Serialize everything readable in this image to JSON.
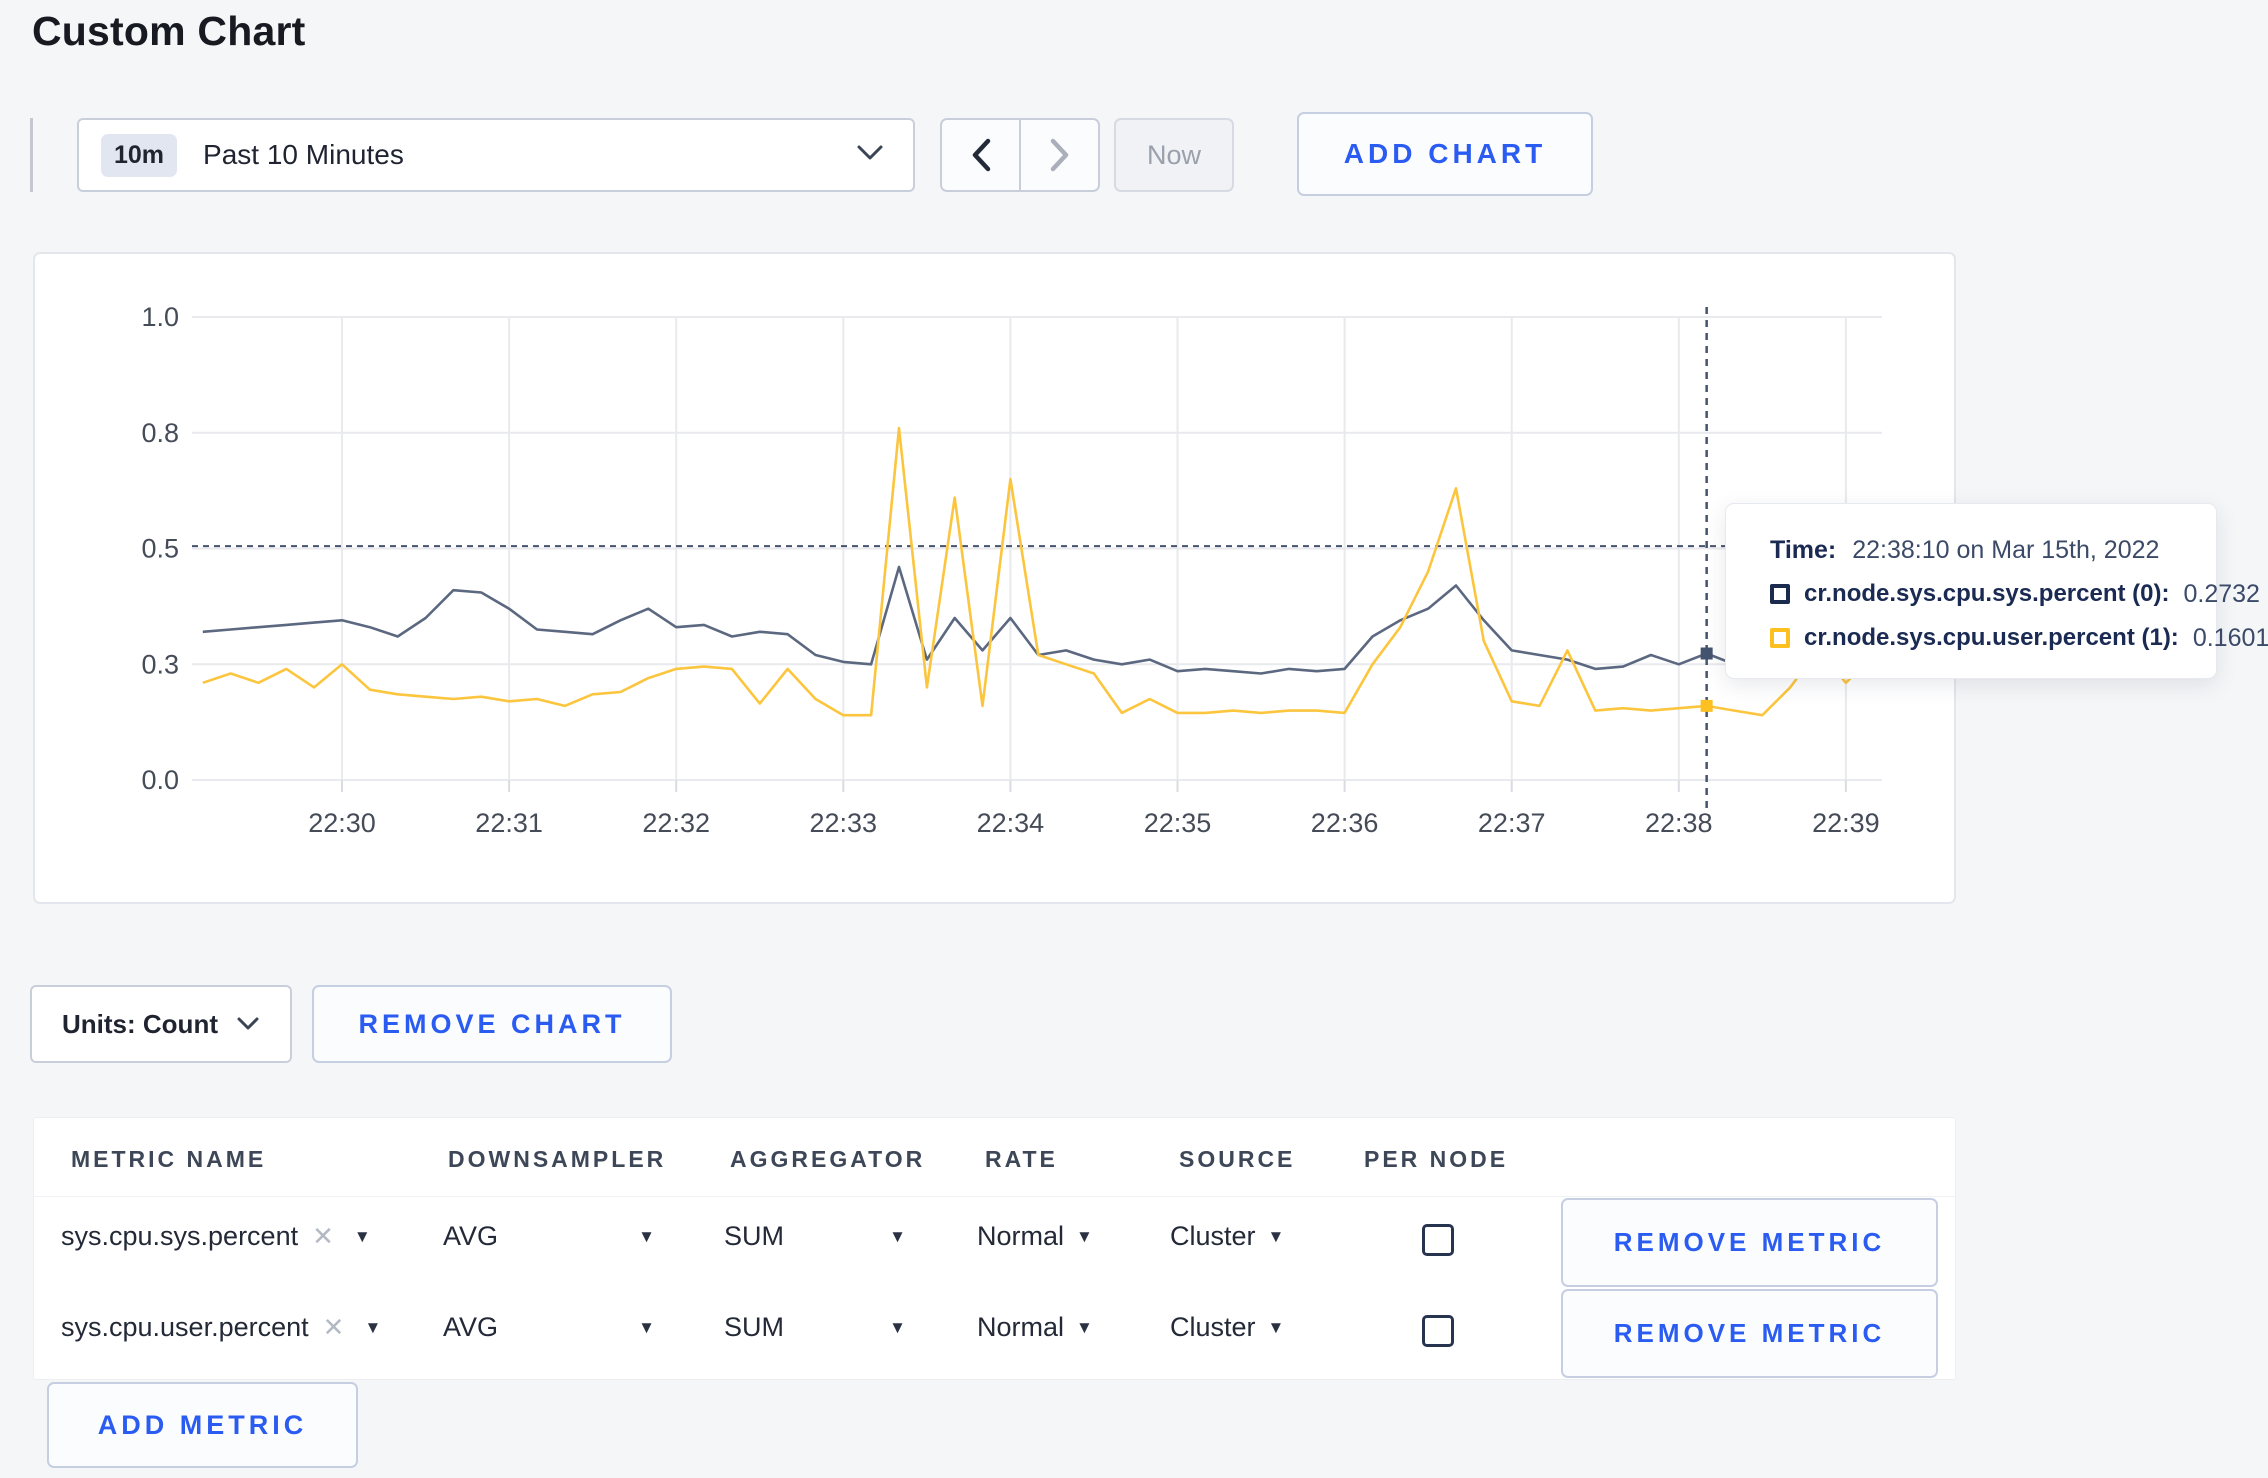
{
  "page": {
    "title": "Custom Chart"
  },
  "colors": {
    "accent_blue": "#2b5cf2",
    "series_sys": "#5b6880",
    "series_user": "#fcc53e",
    "swatch_sys": "#1b2b4e",
    "swatch_user": "#fdc021",
    "crosshair": "#45536e",
    "gridline": "#e9eaee",
    "axis_text": "#454b57"
  },
  "toolbar": {
    "time_range_badge": "10m",
    "time_range_label": "Past 10 Minutes",
    "now_label": "Now",
    "add_chart_label": "ADD CHART"
  },
  "tooltip": {
    "time_label": "Time:",
    "time_value": "22:38:10 on Mar 15th, 2022",
    "series": [
      {
        "label": "cr.node.sys.cpu.sys.percent (0):",
        "value": "0.2732",
        "color": "#1b2b4e"
      },
      {
        "label": "cr.node.sys.cpu.user.percent (1):",
        "value": "0.1601",
        "color": "#fdc021"
      }
    ]
  },
  "chart_controls": {
    "units_label": "Units: Count",
    "remove_chart_label": "REMOVE CHART"
  },
  "metrics_table": {
    "headers": [
      "METRIC NAME",
      "DOWNSAMPLER",
      "AGGREGATOR",
      "RATE",
      "SOURCE",
      "PER NODE"
    ],
    "rows": [
      {
        "metric": "sys.cpu.sys.percent",
        "downsampler": "AVG",
        "aggregator": "SUM",
        "rate": "Normal",
        "source": "Cluster",
        "per_node_checked": false,
        "remove_label": "REMOVE METRIC"
      },
      {
        "metric": "sys.cpu.user.percent",
        "downsampler": "AVG",
        "aggregator": "SUM",
        "rate": "Normal",
        "source": "Cluster",
        "per_node_checked": false,
        "remove_label": "REMOVE METRIC"
      }
    ],
    "add_metric_label": "ADD METRIC"
  },
  "chart_data": {
    "type": "line",
    "title": "",
    "xlabel": "",
    "ylabel": "",
    "ylim": [
      0,
      1
    ],
    "grid": true,
    "y_ticks": [
      {
        "v": 0.0,
        "label": "0.0"
      },
      {
        "v": 0.25,
        "label": "0.3"
      },
      {
        "v": 0.5,
        "label": "0.5"
      },
      {
        "v": 0.75,
        "label": "0.8"
      },
      {
        "v": 1.0,
        "label": "1.0"
      }
    ],
    "x_ticks": [
      "22:30",
      "22:31",
      "22:32",
      "22:33",
      "22:34",
      "22:35",
      "22:36",
      "22:37",
      "22:38",
      "22:39"
    ],
    "x": [
      "22:29:10",
      "22:29:20",
      "22:29:30",
      "22:29:40",
      "22:29:50",
      "22:30:00",
      "22:30:10",
      "22:30:20",
      "22:30:30",
      "22:30:40",
      "22:30:50",
      "22:31:00",
      "22:31:10",
      "22:31:20",
      "22:31:30",
      "22:31:40",
      "22:31:50",
      "22:32:00",
      "22:32:10",
      "22:32:20",
      "22:32:30",
      "22:32:40",
      "22:32:50",
      "22:33:00",
      "22:33:10",
      "22:33:20",
      "22:33:30",
      "22:33:40",
      "22:33:50",
      "22:34:00",
      "22:34:10",
      "22:34:20",
      "22:34:30",
      "22:34:40",
      "22:34:50",
      "22:35:00",
      "22:35:10",
      "22:35:20",
      "22:35:30",
      "22:35:40",
      "22:35:50",
      "22:36:00",
      "22:36:10",
      "22:36:20",
      "22:36:30",
      "22:36:40",
      "22:36:50",
      "22:37:00",
      "22:37:10",
      "22:37:20",
      "22:37:30",
      "22:37:40",
      "22:37:50",
      "22:38:00",
      "22:38:10",
      "22:38:20",
      "22:38:30",
      "22:38:40",
      "22:38:50",
      "22:39:00",
      "22:39:10"
    ],
    "series": [
      {
        "name": "cr.node.sys.cpu.sys.percent (0)",
        "color": "#5b6880",
        "dot_color": "#44536e",
        "values": [
          0.32,
          0.325,
          0.33,
          0.335,
          0.34,
          0.345,
          0.33,
          0.31,
          0.35,
          0.41,
          0.405,
          0.37,
          0.325,
          0.32,
          0.315,
          0.345,
          0.37,
          0.33,
          0.335,
          0.31,
          0.32,
          0.315,
          0.27,
          0.255,
          0.25,
          0.46,
          0.26,
          0.35,
          0.28,
          0.35,
          0.27,
          0.28,
          0.26,
          0.25,
          0.26,
          0.235,
          0.24,
          0.235,
          0.23,
          0.24,
          0.235,
          0.24,
          0.31,
          0.345,
          0.37,
          0.42,
          0.345,
          0.28,
          0.27,
          0.26,
          0.24,
          0.245,
          0.27,
          0.25,
          0.2732,
          0.25,
          0.29,
          0.32,
          0.3,
          0.295,
          0.31
        ]
      },
      {
        "name": "cr.node.sys.cpu.user.percent (1)",
        "color": "#fcc53e",
        "dot_color": "#fdc021",
        "values": [
          0.21,
          0.23,
          0.21,
          0.24,
          0.2,
          0.25,
          0.195,
          0.185,
          0.18,
          0.175,
          0.18,
          0.17,
          0.175,
          0.16,
          0.185,
          0.19,
          0.22,
          0.24,
          0.245,
          0.24,
          0.165,
          0.24,
          0.175,
          0.14,
          0.14,
          0.76,
          0.2,
          0.61,
          0.16,
          0.65,
          0.27,
          0.25,
          0.23,
          0.145,
          0.175,
          0.145,
          0.145,
          0.15,
          0.145,
          0.15,
          0.15,
          0.145,
          0.25,
          0.33,
          0.45,
          0.63,
          0.3,
          0.17,
          0.16,
          0.28,
          0.15,
          0.155,
          0.15,
          0.155,
          0.1601,
          0.15,
          0.14,
          0.2,
          0.28,
          0.21,
          0.27
        ]
      }
    ],
    "crosshair": {
      "time": "22:38:10",
      "hline_value": 0.505,
      "points": [
        {
          "series": 0,
          "value": 0.2732
        },
        {
          "series": 1,
          "value": 0.1601
        }
      ]
    },
    "legend_position": "tooltip"
  }
}
